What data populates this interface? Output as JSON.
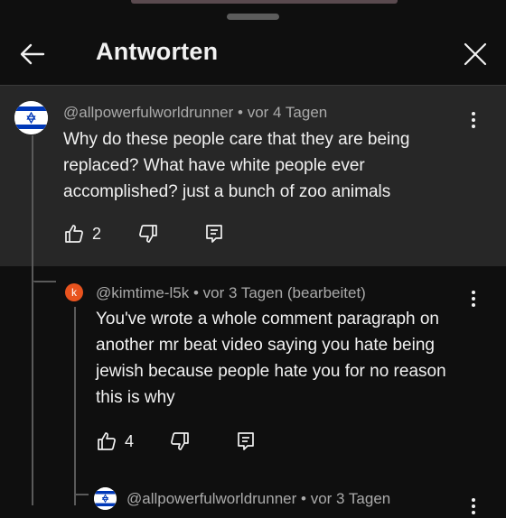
{
  "header": {
    "title": "Antworten"
  },
  "comments": [
    {
      "handle": "@allpowerfulworldrunner",
      "sep": "•",
      "time": "vor 4 Tagen",
      "lines": [
        "Why do these people care that they are being",
        "replaced? What have white people ever",
        "accomplished? just a bunch of zoo animals"
      ],
      "likes": "2"
    },
    {
      "avatar_letter": "k",
      "handle": "@kimtime-l5k",
      "sep": "•",
      "time": "vor 3 Tagen (bearbeitet)",
      "lines": [
        "You've wrote a whole comment paragraph on",
        "another mr beat video saying you hate being",
        "jewish because people hate you for no reason",
        "this is why"
      ],
      "likes": "4"
    },
    {
      "handle": "@allpowerfulworldrunner",
      "sep": "•",
      "time": "vor 3 Tagen"
    }
  ],
  "colors": {
    "accent_avatar": "#e8531e",
    "parent_bg": "#272727",
    "flag_blue": "#0038b8"
  }
}
